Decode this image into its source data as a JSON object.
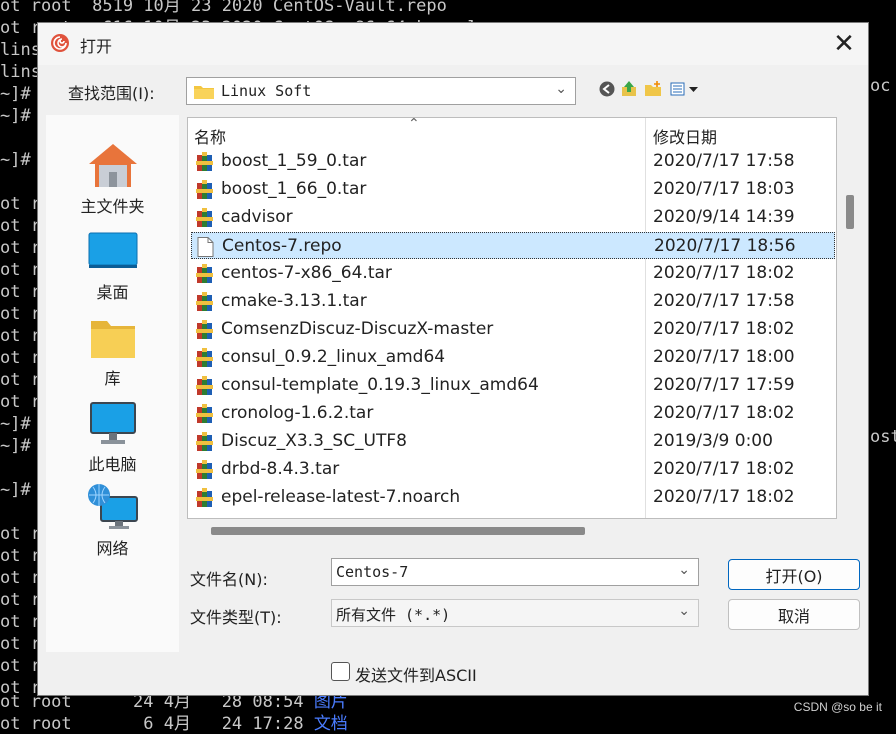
{
  "terminal": {
    "lines": [
      "ot root  8519 10月 23 2020 CentOS-Vault.repo",
      "ot root   616 10月 23 2020 CentOS-x86_64-kernel.repo",
      "lins",
      "lins",
      "~]#",
      "~]#",
      "",
      "~]#",
      "",
      "ot r",
      "ot r",
      "ot r",
      "ot r",
      "ot r",
      "ot r",
      "ot r",
      "ot r",
      "ot r",
      "ot r",
      "~]#",
      "~]#",
      "",
      "~]#",
      "",
      "ot r",
      "ot r",
      "ot r",
      "ot r",
      "ot r",
      "ot r",
      "ot r",
      "ot r"
    ],
    "right_fragments": [
      "oc",
      "ost"
    ],
    "bottom_lines": [
      {
        "text": "ot root      24 4月   28 08:54 ",
        "link": "图片"
      },
      {
        "text": "ot root       6 4月   24 17:28 ",
        "link": "文档"
      }
    ],
    "watermark": "CSDN @so be it"
  },
  "dialog": {
    "title": "打开",
    "close_glyph": "✕",
    "look_in_label": "查找范围(I):",
    "look_in_value": "Linux Soft",
    "places": [
      {
        "label": "主文件夹",
        "icon": "home-icon"
      },
      {
        "label": "桌面",
        "icon": "desktop-icon"
      },
      {
        "label": "库",
        "icon": "library-folder-icon"
      },
      {
        "label": "此电脑",
        "icon": "computer-icon"
      },
      {
        "label": "网络",
        "icon": "network-icon"
      }
    ],
    "columns": {
      "name": "名称",
      "modified": "修改日期"
    },
    "files": [
      {
        "name": "boost_1_59_0.tar",
        "date": "2020/7/17 17:58",
        "icon": "archive-icon"
      },
      {
        "name": "boost_1_66_0.tar",
        "date": "2020/7/17 18:03",
        "icon": "archive-icon"
      },
      {
        "name": "cadvisor",
        "date": "2020/9/14 14:39",
        "icon": "archive-icon"
      },
      {
        "name": "Centos-7.repo",
        "date": "2020/7/17 18:56",
        "icon": "document-icon",
        "selected": true
      },
      {
        "name": "centos-7-x86_64.tar",
        "date": "2020/7/17 18:02",
        "icon": "archive-icon"
      },
      {
        "name": "cmake-3.13.1.tar",
        "date": "2020/7/17 17:58",
        "icon": "archive-icon"
      },
      {
        "name": "ComsenzDiscuz-DiscuzX-master",
        "date": "2020/7/17 18:02",
        "icon": "archive-icon"
      },
      {
        "name": "consul_0.9.2_linux_amd64",
        "date": "2020/7/17 18:00",
        "icon": "archive-icon"
      },
      {
        "name": "consul-template_0.19.3_linux_amd64",
        "date": "2020/7/17 17:59",
        "icon": "archive-icon"
      },
      {
        "name": "cronolog-1.6.2.tar",
        "date": "2020/7/17 18:02",
        "icon": "archive-icon"
      },
      {
        "name": "Discuz_X3.3_SC_UTF8",
        "date": "2019/3/9 0:00",
        "icon": "archive-icon"
      },
      {
        "name": "drbd-8.4.3.tar",
        "date": "2020/7/17 18:02",
        "icon": "archive-icon"
      },
      {
        "name": "epel-release-latest-7.noarch",
        "date": "2020/7/17 18:02",
        "icon": "archive-icon"
      }
    ],
    "filename_label": "文件名(N):",
    "filename_value": "Centos-7",
    "filetype_label": "文件类型(T):",
    "filetype_value": "所有文件 (*.*)",
    "open_button": "打开(O)",
    "cancel_button": "取消",
    "send_ascii_label": "发送文件到ASCII",
    "send_ascii_checked": false
  },
  "colors": {
    "selection": "#cce8ff",
    "accent": "#0067c0",
    "link": "#4a7cff"
  }
}
